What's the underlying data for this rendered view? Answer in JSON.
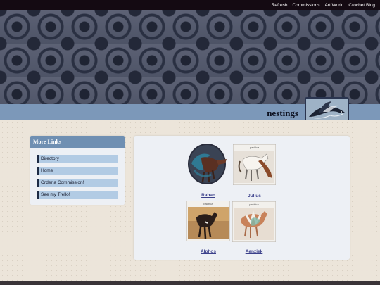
{
  "topnav": {
    "links": [
      "Refresh",
      "Commissions",
      "Art World",
      "Crochet Blog"
    ]
  },
  "site": {
    "title": "nestings"
  },
  "sidebar": {
    "heading": "More Links",
    "items": [
      "Directory",
      "Home",
      "Order a Commission!",
      "See my Trello!"
    ]
  },
  "gallery": {
    "items": [
      {
        "name": "Raban",
        "art_text": ""
      },
      {
        "name": "Julius",
        "art_text": "pacifica"
      },
      {
        "name": "Alphos",
        "art_text": "pacifica"
      },
      {
        "name": "Aenziek",
        "art_text": "pacifica"
      }
    ]
  },
  "colors": {
    "topbar": "#140a12",
    "titlebar": "#7c98b9",
    "nav_item": "#b2cbe4",
    "link": "#3a3f8a"
  }
}
